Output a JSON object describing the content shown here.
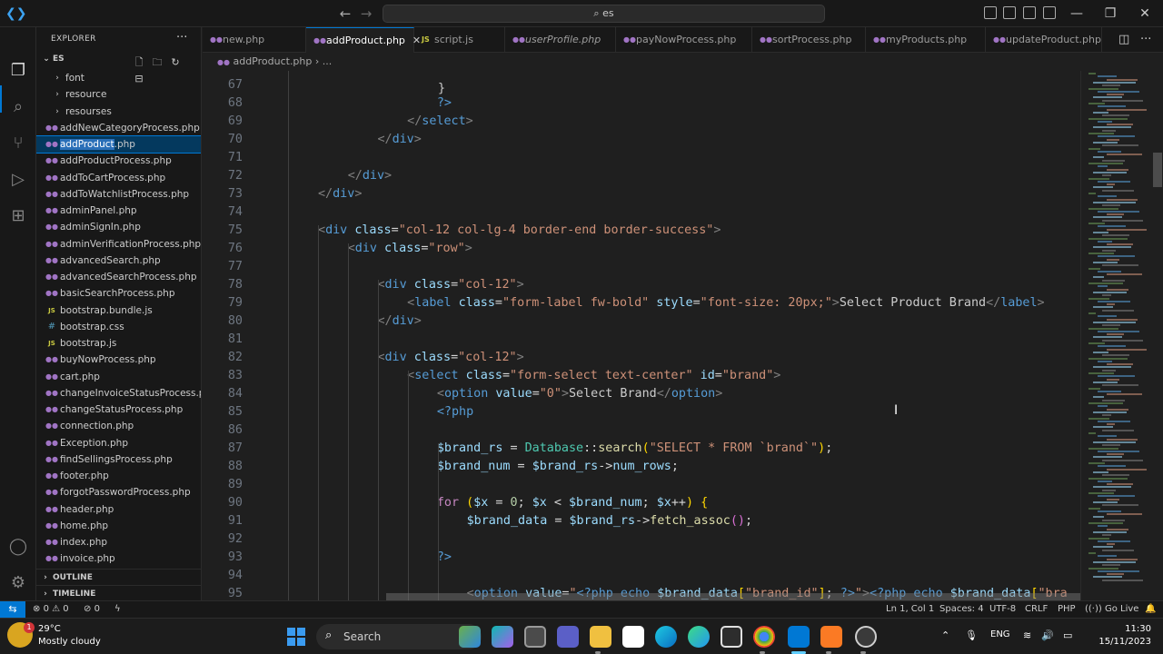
{
  "titlebar": {
    "search_text": "es",
    "back_icon": "arrow-left",
    "forward_icon": "arrow-right"
  },
  "sidebar": {
    "title": "EXPLORER",
    "root_label": "ES",
    "folders": [
      "font",
      "resource",
      "resourses"
    ],
    "files": [
      {
        "name": "addNewCategoryProcess.php",
        "type": "php"
      },
      {
        "name": "addProduct.php",
        "type": "php",
        "selected": true,
        "highlight": "addProduct",
        "rest": ".php"
      },
      {
        "name": "addProductProcess.php",
        "type": "php"
      },
      {
        "name": "addToCartProcess.php",
        "type": "php"
      },
      {
        "name": "addToWatchlistProcess.php",
        "type": "php"
      },
      {
        "name": "adminPanel.php",
        "type": "php"
      },
      {
        "name": "adminSignIn.php",
        "type": "php"
      },
      {
        "name": "adminVerificationProcess.php",
        "type": "php"
      },
      {
        "name": "advancedSearch.php",
        "type": "php"
      },
      {
        "name": "advancedSearchProcess.php",
        "type": "php"
      },
      {
        "name": "basicSearchProcess.php",
        "type": "php"
      },
      {
        "name": "bootstrap.bundle.js",
        "type": "js"
      },
      {
        "name": "bootstrap.css",
        "type": "css"
      },
      {
        "name": "bootstrap.js",
        "type": "js"
      },
      {
        "name": "buyNowProcess.php",
        "type": "php"
      },
      {
        "name": "cart.php",
        "type": "php"
      },
      {
        "name": "changeInvoiceStatusProcess.p...",
        "type": "php"
      },
      {
        "name": "changeStatusProcess.php",
        "type": "php"
      },
      {
        "name": "connection.php",
        "type": "php"
      },
      {
        "name": "Exception.php",
        "type": "php"
      },
      {
        "name": "findSellingsProcess.php",
        "type": "php"
      },
      {
        "name": "footer.php",
        "type": "php"
      },
      {
        "name": "forgotPasswordProcess.php",
        "type": "php"
      },
      {
        "name": "header.php",
        "type": "php"
      },
      {
        "name": "home.php",
        "type": "php"
      },
      {
        "name": "index.php",
        "type": "php"
      },
      {
        "name": "invoice.php",
        "type": "php"
      }
    ],
    "outline_label": "OUTLINE",
    "timeline_label": "TIMELINE"
  },
  "tabs": [
    {
      "label": "new.php",
      "type": "php"
    },
    {
      "label": "addProduct.php",
      "type": "php",
      "active": true
    },
    {
      "label": "script.js",
      "type": "js"
    },
    {
      "label": "userProfile.php",
      "type": "php",
      "italic": true
    },
    {
      "label": "payNowProcess.php",
      "type": "php"
    },
    {
      "label": "sortProcess.php",
      "type": "php"
    },
    {
      "label": "myProducts.php",
      "type": "php"
    },
    {
      "label": "updateProduct.php",
      "type": "php"
    }
  ],
  "breadcrumb": {
    "file": "addProduct.php",
    "rest": "..."
  },
  "editor": {
    "partial_top": "}",
    "lines": [
      {
        "n": "67",
        "c": []
      },
      {
        "n": "68",
        "c": [
          [
            "t-php",
            "?>"
          ]
        ],
        "indent": 16
      },
      {
        "n": "69",
        "c": [
          [
            "t-tag",
            "</"
          ],
          [
            "t-name",
            "select"
          ],
          [
            "t-tag",
            ">"
          ]
        ],
        "indent": 12
      },
      {
        "n": "70",
        "c": [
          [
            "t-tag",
            "</"
          ],
          [
            "t-name",
            "div"
          ],
          [
            "t-tag",
            ">"
          ]
        ],
        "indent": 8
      },
      {
        "n": "71",
        "c": []
      },
      {
        "n": "72",
        "c": [
          [
            "t-tag",
            "</"
          ],
          [
            "t-name",
            "div"
          ],
          [
            "t-tag",
            ">"
          ]
        ],
        "indent": 4
      },
      {
        "n": "73",
        "c": [
          [
            "t-tag",
            "</"
          ],
          [
            "t-name",
            "div"
          ],
          [
            "t-tag",
            ">"
          ]
        ],
        "indent": 0
      },
      {
        "n": "74",
        "c": []
      },
      {
        "n": "75",
        "c": [
          [
            "t-tag",
            "<"
          ],
          [
            "t-name",
            "div "
          ],
          [
            "t-attr",
            "class"
          ],
          [
            "t-op",
            "="
          ],
          [
            "t-str",
            "\"col-12 col-lg-4 border-end border-success\""
          ],
          [
            "t-tag",
            ">"
          ]
        ],
        "indent": 0
      },
      {
        "n": "76",
        "c": [
          [
            "t-tag",
            "<"
          ],
          [
            "t-name",
            "div "
          ],
          [
            "t-attr",
            "class"
          ],
          [
            "t-op",
            "="
          ],
          [
            "t-str",
            "\"row\""
          ],
          [
            "t-tag",
            ">"
          ]
        ],
        "indent": 4
      },
      {
        "n": "77",
        "c": []
      },
      {
        "n": "78",
        "c": [
          [
            "t-tag",
            "<"
          ],
          [
            "t-name",
            "div "
          ],
          [
            "t-attr",
            "class"
          ],
          [
            "t-op",
            "="
          ],
          [
            "t-str",
            "\"col-12\""
          ],
          [
            "t-tag",
            ">"
          ]
        ],
        "indent": 8
      },
      {
        "n": "79",
        "c": [
          [
            "t-tag",
            "<"
          ],
          [
            "t-name",
            "label "
          ],
          [
            "t-attr",
            "class"
          ],
          [
            "t-op",
            "="
          ],
          [
            "t-str",
            "\"form-label fw-bold\" "
          ],
          [
            "t-attr",
            "style"
          ],
          [
            "t-op",
            "="
          ],
          [
            "t-str",
            "\"font-size: 20px;\""
          ],
          [
            "t-tag",
            ">"
          ],
          [
            "t-txt",
            "Select Product Brand"
          ],
          [
            "t-tag",
            "</"
          ],
          [
            "t-name",
            "label"
          ],
          [
            "t-tag",
            ">"
          ]
        ],
        "indent": 12
      },
      {
        "n": "80",
        "c": [
          [
            "t-tag",
            "</"
          ],
          [
            "t-name",
            "div"
          ],
          [
            "t-tag",
            ">"
          ]
        ],
        "indent": 8
      },
      {
        "n": "81",
        "c": []
      },
      {
        "n": "82",
        "c": [
          [
            "t-tag",
            "<"
          ],
          [
            "t-name",
            "div "
          ],
          [
            "t-attr",
            "class"
          ],
          [
            "t-op",
            "="
          ],
          [
            "t-str",
            "\"col-12\""
          ],
          [
            "t-tag",
            ">"
          ]
        ],
        "indent": 8
      },
      {
        "n": "83",
        "c": [
          [
            "t-tag",
            "<"
          ],
          [
            "t-name",
            "select "
          ],
          [
            "t-attr",
            "class"
          ],
          [
            "t-op",
            "="
          ],
          [
            "t-str",
            "\"form-select text-center\" "
          ],
          [
            "t-attr",
            "id"
          ],
          [
            "t-op",
            "="
          ],
          [
            "t-str",
            "\"brand\""
          ],
          [
            "t-tag",
            ">"
          ]
        ],
        "indent": 12
      },
      {
        "n": "84",
        "c": [
          [
            "t-tag",
            "<"
          ],
          [
            "t-name",
            "option "
          ],
          [
            "t-attr",
            "value"
          ],
          [
            "t-op",
            "="
          ],
          [
            "t-str",
            "\"0\""
          ],
          [
            "t-tag",
            ">"
          ],
          [
            "t-txt",
            "Select Brand"
          ],
          [
            "t-tag",
            "</"
          ],
          [
            "t-name",
            "option"
          ],
          [
            "t-tag",
            ">"
          ]
        ],
        "indent": 16
      },
      {
        "n": "85",
        "c": [
          [
            "t-php",
            "<?php"
          ]
        ],
        "indent": 16
      },
      {
        "n": "86",
        "c": []
      },
      {
        "n": "87",
        "c": [
          [
            "t-var",
            "$brand_rs"
          ],
          [
            "t-op",
            " = "
          ],
          [
            "t-cls",
            "Database"
          ],
          [
            "t-op",
            "::"
          ],
          [
            "t-fn",
            "search"
          ],
          [
            "t-br1",
            "("
          ],
          [
            "t-str",
            "\"SELECT * FROM `brand`\""
          ],
          [
            "t-br1",
            ")"
          ],
          [
            "t-op",
            ";"
          ]
        ],
        "indent": 16
      },
      {
        "n": "88",
        "c": [
          [
            "t-var",
            "$brand_num"
          ],
          [
            "t-op",
            " = "
          ],
          [
            "t-var",
            "$brand_rs"
          ],
          [
            "t-op",
            "->"
          ],
          [
            "t-var",
            "num_rows"
          ],
          [
            "t-op",
            ";"
          ]
        ],
        "indent": 16
      },
      {
        "n": "89",
        "c": []
      },
      {
        "n": "90",
        "c": [
          [
            "t-kw",
            "for"
          ],
          [
            "t-op",
            " "
          ],
          [
            "t-br1",
            "("
          ],
          [
            "t-var",
            "$x"
          ],
          [
            "t-op",
            " = "
          ],
          [
            "t-num",
            "0"
          ],
          [
            "t-op",
            "; "
          ],
          [
            "t-var",
            "$x"
          ],
          [
            "t-op",
            " < "
          ],
          [
            "t-var",
            "$brand_num"
          ],
          [
            "t-op",
            "; "
          ],
          [
            "t-var",
            "$x"
          ],
          [
            "t-op",
            "++"
          ],
          [
            "t-br1",
            ")"
          ],
          [
            "t-op",
            " "
          ],
          [
            "t-br1",
            "{"
          ]
        ],
        "indent": 16
      },
      {
        "n": "91",
        "c": [
          [
            "t-var",
            "$brand_data"
          ],
          [
            "t-op",
            " = "
          ],
          [
            "t-var",
            "$brand_rs"
          ],
          [
            "t-op",
            "->"
          ],
          [
            "t-fn",
            "fetch_assoc"
          ],
          [
            "t-br2",
            "()"
          ],
          [
            "t-op",
            ";"
          ]
        ],
        "indent": 20
      },
      {
        "n": "92",
        "c": []
      },
      {
        "n": "93",
        "c": [
          [
            "t-php",
            "?>"
          ]
        ],
        "indent": 16
      },
      {
        "n": "94",
        "c": []
      },
      {
        "n": "95",
        "c": [
          [
            "t-tag",
            "<"
          ],
          [
            "t-name",
            "option "
          ],
          [
            "t-attr",
            "value"
          ],
          [
            "t-op",
            "="
          ],
          [
            "t-str",
            "\""
          ],
          [
            "t-php",
            "<?php "
          ],
          [
            "t-name",
            "echo "
          ],
          [
            "t-var",
            "$brand_data"
          ],
          [
            "t-br1",
            "["
          ],
          [
            "t-str",
            "\"brand_id\""
          ],
          [
            "t-br1",
            "]"
          ],
          [
            "t-op",
            "; "
          ],
          [
            "t-php",
            "?>"
          ],
          [
            "t-str",
            "\""
          ],
          [
            "t-tag",
            ">"
          ],
          [
            "t-php",
            "<?php "
          ],
          [
            "t-name",
            "echo "
          ],
          [
            "t-var",
            "$brand_data"
          ],
          [
            "t-br1",
            "["
          ],
          [
            "t-str",
            "\"bra"
          ]
        ],
        "indent": 20
      }
    ]
  },
  "statusbar": {
    "errors": "0",
    "warnings": "0",
    "ports": "0",
    "position": "Ln 1, Col 1",
    "spaces": "Spaces: 4",
    "encoding": "UTF-8",
    "eol": "CRLF",
    "language": "PHP",
    "golive": "Go Live"
  },
  "taskbar": {
    "weather_temp": "29°C",
    "weather_desc": "Mostly cloudy",
    "weather_badge": "1",
    "search_label": "Search",
    "lang": "ENG",
    "time": "11:30",
    "date": "15/11/2023"
  },
  "colors": {
    "accent": "#0078d4",
    "editor_bg": "#1f1f1f",
    "chrome_bg": "#181818"
  }
}
